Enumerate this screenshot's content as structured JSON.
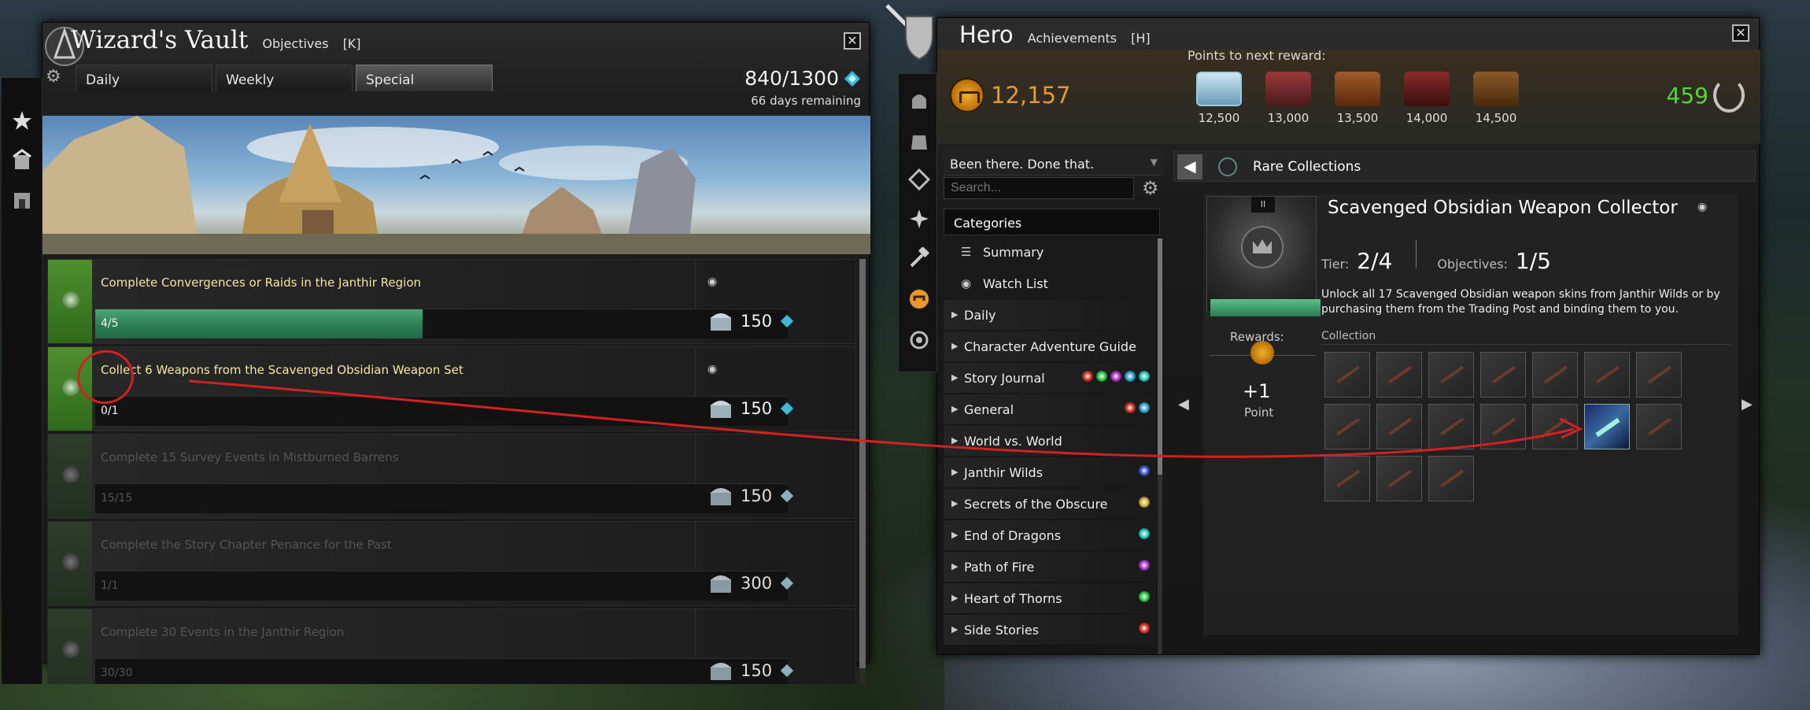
{
  "wizard_vault": {
    "title": "Wizard's Vault",
    "subtitle": "Objectives",
    "hotkey": "[K]",
    "close": "✕",
    "tabs": [
      "Daily",
      "Weekly",
      "Special"
    ],
    "active_tab": "Special",
    "points": "840/1300",
    "days_remaining": "66 days remaining",
    "objectives": [
      {
        "title": "Complete Convergences or Raids in the Janthir Region",
        "progress": "4/5",
        "progress_fraction": 0.8,
        "reward": "150",
        "done": false
      },
      {
        "title": "Collect 6 Weapons from the Scavenged Obsidian Weapon Set",
        "progress": "0/1",
        "progress_fraction": 0,
        "reward": "150",
        "done": false
      },
      {
        "title": "Complete 15 Survey Events in Mistburned Barrens",
        "progress": "15/15",
        "progress_fraction": 1,
        "reward": "150",
        "done": true
      },
      {
        "title": "Complete the Story Chapter Penance for the Past",
        "progress": "1/1",
        "progress_fraction": 1,
        "reward": "300",
        "done": true
      },
      {
        "title": "Complete 30 Events in the Janthir Region",
        "progress": "30/30",
        "progress_fraction": 1,
        "reward": "150",
        "done": true
      }
    ]
  },
  "hero": {
    "title": "Hero",
    "subtitle": "Achievements",
    "hotkey": "[H]",
    "close": "✕",
    "points_next_label": "Points to next reward:",
    "achievement_points": "12,157",
    "reward_chests": [
      "12,500",
      "13,000",
      "13,500",
      "14,000",
      "14,500"
    ],
    "mastery_points": "459",
    "dropdown": "Been there. Done that.",
    "search_placeholder": "Search...",
    "categories_label": "Categories",
    "categories": [
      {
        "label": "Summary",
        "type": "sub",
        "icon": "list-icon"
      },
      {
        "label": "Watch List",
        "type": "sub",
        "icon": "eye-icon"
      },
      {
        "label": "Daily",
        "type": "group"
      },
      {
        "label": "Character Adventure Guide",
        "type": "group"
      },
      {
        "label": "Story Journal",
        "type": "group",
        "gems": [
          "#d83a2a",
          "#2ed34a",
          "#b23ad8",
          "#3aa8d8",
          "#2ed3c0"
        ]
      },
      {
        "label": "General",
        "type": "group",
        "gems": [
          "#d83a2a",
          "#3aa8d8"
        ]
      },
      {
        "label": "World vs. World",
        "type": "group"
      },
      {
        "label": "Janthir Wilds",
        "type": "group",
        "gems": [
          "#3a5ad8"
        ]
      },
      {
        "label": "Secrets of the Obscure",
        "type": "group",
        "gems": [
          "#d8b83a"
        ]
      },
      {
        "label": "End of Dragons",
        "type": "group",
        "gems": [
          "#2ed3c0"
        ]
      },
      {
        "label": "Path of Fire",
        "type": "group",
        "gems": [
          "#b23ad8"
        ]
      },
      {
        "label": "Heart of Thorns",
        "type": "group",
        "gems": [
          "#2ed34a"
        ]
      },
      {
        "label": "Side Stories",
        "type": "group",
        "gems": [
          "#d83a2a"
        ]
      }
    ],
    "collection_header": "Rare Collections",
    "achievement": {
      "tier_badge": "II",
      "name": "Scavenged Obsidian Weapon Collector",
      "tier_label": "Tier:",
      "tier": "2/4",
      "objectives_label": "Objectives:",
      "objectives": "1/5",
      "description": "Unlock all 17 Scavenged Obsidian weapon skins from Janthir Wilds or by purchasing them from the Trading Post and binding them to you.",
      "collection_label": "Collection",
      "rewards_label": "Rewards:",
      "reward_value": "+1",
      "reward_unit": "Point",
      "slots": [
        false,
        false,
        false,
        false,
        false,
        false,
        false,
        false,
        false,
        false,
        false,
        false,
        true,
        false,
        false,
        false,
        false
      ]
    }
  },
  "annotation_color": "#d42020"
}
